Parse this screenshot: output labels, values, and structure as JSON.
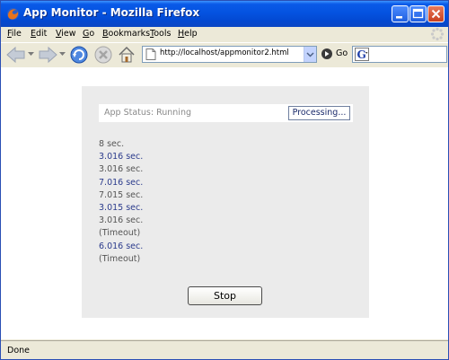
{
  "window": {
    "title": "App Monitor - Mozilla Firefox"
  },
  "menubar": {
    "items": [
      {
        "label": "File"
      },
      {
        "label": "Edit"
      },
      {
        "label": "View"
      },
      {
        "label": "Go"
      },
      {
        "label": "Bookmarks"
      },
      {
        "label": "Tools"
      },
      {
        "label": "Help"
      }
    ]
  },
  "navbar": {
    "url": "http://localhost/appmonitor2.html",
    "go_label": "Go",
    "search_engine_icon": "google-g-icon"
  },
  "app": {
    "status_text": "App Status: Running",
    "processing_label": "Processing...",
    "results": [
      {
        "text": "8 sec.",
        "tone": "gray"
      },
      {
        "text": "3.016 sec.",
        "tone": "blue"
      },
      {
        "text": "3.016 sec.",
        "tone": "gray"
      },
      {
        "text": "7.016 sec.",
        "tone": "blue"
      },
      {
        "text": "7.015 sec.",
        "tone": "gray"
      },
      {
        "text": "3.015 sec.",
        "tone": "blue"
      },
      {
        "text": "3.016 sec.",
        "tone": "gray"
      },
      {
        "text": "(Timeout)",
        "tone": "gray"
      },
      {
        "text": "6.016 sec.",
        "tone": "blue"
      },
      {
        "text": "(Timeout)",
        "tone": "gray"
      }
    ],
    "stop_label": "Stop"
  },
  "statusbar": {
    "text": "Done"
  },
  "colors": {
    "titlebar": "#0453e0",
    "chrome": "#ece9d8",
    "panel": "#ebebeb",
    "result_gray": "#555555",
    "result_blue": "#2b3b8c"
  }
}
